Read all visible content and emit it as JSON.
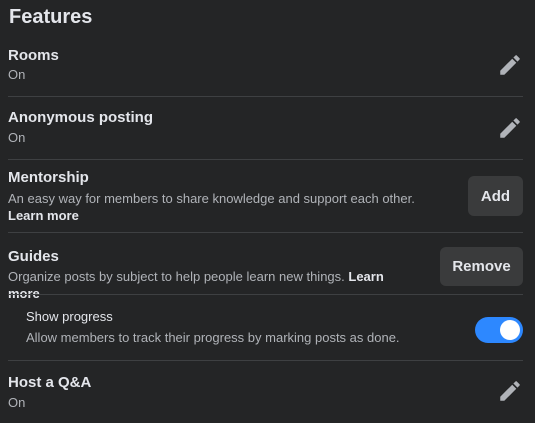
{
  "heading": "Features",
  "rooms": {
    "title": "Rooms",
    "status": "On"
  },
  "anon": {
    "title": "Anonymous posting",
    "status": "On"
  },
  "mentorship": {
    "title": "Mentorship",
    "description": "An easy way for members to share knowledge and support each other.",
    "learn_more": "Learn more",
    "button": "Add"
  },
  "guides": {
    "title": "Guides",
    "description": "Organize posts by subject to help people learn new things.",
    "learn_more": "Learn more",
    "button": "Remove"
  },
  "progress": {
    "title": "Show progress",
    "description": "Allow members to track their progress by marking posts as done.",
    "toggle_on": true
  },
  "qa": {
    "title": "Host a Q&A",
    "status": "On"
  },
  "colors": {
    "toggle_on": "#2d88ff",
    "background": "#242526",
    "button": "#3a3b3c"
  },
  "icons": {
    "edit": "pencil-icon"
  }
}
